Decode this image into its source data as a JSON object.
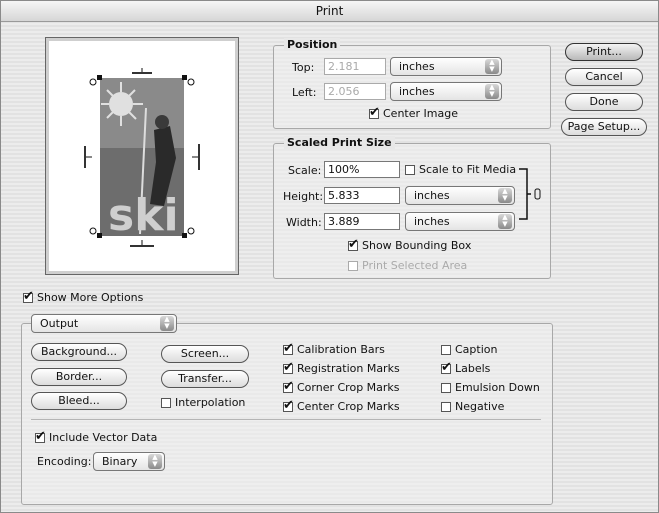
{
  "window": {
    "title": "Print"
  },
  "position": {
    "label": "Position",
    "top_label": "Top:",
    "top_value": "2.181",
    "top_unit": "inches",
    "left_label": "Left:",
    "left_value": "2.056",
    "left_unit": "inches",
    "center_image": "Center Image"
  },
  "scaled": {
    "label": "Scaled Print Size",
    "scale_label": "Scale:",
    "scale_value": "100%",
    "scale_to_fit": "Scale to Fit Media",
    "height_label": "Height:",
    "height_value": "5.833",
    "height_unit": "inches",
    "width_label": "Width:",
    "width_value": "3.889",
    "width_unit": "inches",
    "show_bbox": "Show Bounding Box",
    "print_selected": "Print Selected Area"
  },
  "buttons": {
    "print": "Print...",
    "cancel": "Cancel",
    "done": "Done",
    "page_setup": "Page Setup..."
  },
  "show_more": "Show More Options",
  "output": {
    "menu": "Output",
    "background": "Background...",
    "border": "Border...",
    "bleed": "Bleed...",
    "screen": "Screen...",
    "transfer": "Transfer...",
    "interpolation": "Interpolation",
    "calibration_bars": "Calibration Bars",
    "registration_marks": "Registration Marks",
    "corner_crop": "Corner Crop Marks",
    "center_crop": "Center Crop Marks",
    "caption": "Caption",
    "labels": "Labels",
    "emulsion_down": "Emulsion Down",
    "negative": "Negative",
    "include_vector": "Include Vector Data",
    "encoding_label": "Encoding:",
    "encoding_value": "Binary"
  },
  "preview_art": {
    "text": "ski"
  }
}
